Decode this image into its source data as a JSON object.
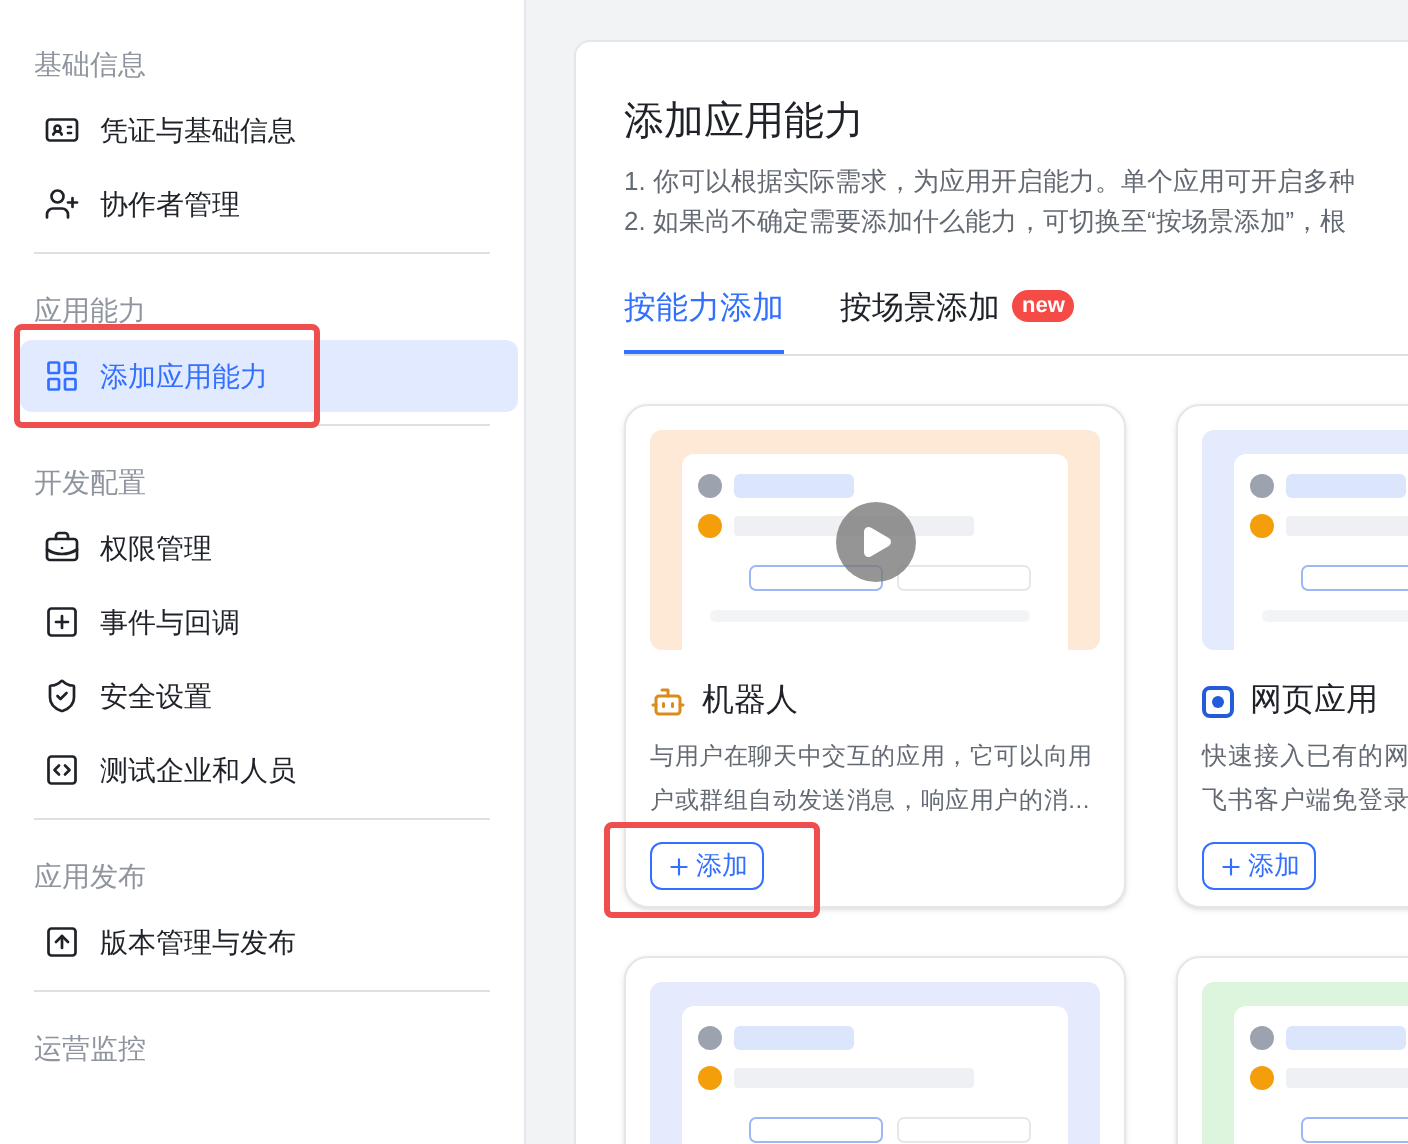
{
  "sidebar": {
    "sections": [
      {
        "heading": "基础信息",
        "items": [
          {
            "label": "凭证与基础信息",
            "selected": false,
            "annotated": false
          },
          {
            "label": "协作者管理",
            "selected": false,
            "annotated": false
          }
        ]
      },
      {
        "heading": "应用能力",
        "items": [
          {
            "label": "添加应用能力",
            "selected": true,
            "annotated": true
          }
        ]
      },
      {
        "heading": "开发配置",
        "items": [
          {
            "label": "权限管理",
            "selected": false,
            "annotated": false
          },
          {
            "label": "事件与回调",
            "selected": false,
            "annotated": false
          },
          {
            "label": "安全设置",
            "selected": false,
            "annotated": false
          },
          {
            "label": "测试企业和人员",
            "selected": false,
            "annotated": false
          }
        ]
      },
      {
        "heading": "应用发布",
        "items": [
          {
            "label": "版本管理与发布",
            "selected": false,
            "annotated": false
          }
        ]
      },
      {
        "heading": "运营监控"
      }
    ]
  },
  "main": {
    "title": "添加应用能力",
    "notes": [
      "1. 你可以根据实际需求，为应用开启能力。单个应用可开启多种",
      "2. 如果尚不确定需要添加什么能力，可切换至“按场景添加”，根"
    ],
    "tabs": [
      {
        "label": "按能力添加",
        "selected": true
      },
      {
        "label": "按场景添加",
        "selected": false,
        "badge": "new"
      }
    ],
    "cards": [
      {
        "preview": {
          "kind": "picture",
          "video": true
        },
        "title": "机器人",
        "description": "与用户在聊天中交互的应用，它可以向用户或群组自动发送消息，响应用户的消...",
        "button": "添加",
        "annotated": true
      },
      {
        "preview": {
          "kind": "picture",
          "video": false
        },
        "title": "网页应用",
        "description_lines": [
          "快速接入已有的网",
          "飞书客户端免登录"
        ],
        "button": "添加",
        "annotated": false
      },
      {
        "preview": {
          "kind": "picture",
          "video": false
        }
      },
      {
        "preview": {
          "kind": "picture",
          "video": false
        }
      }
    ]
  }
}
